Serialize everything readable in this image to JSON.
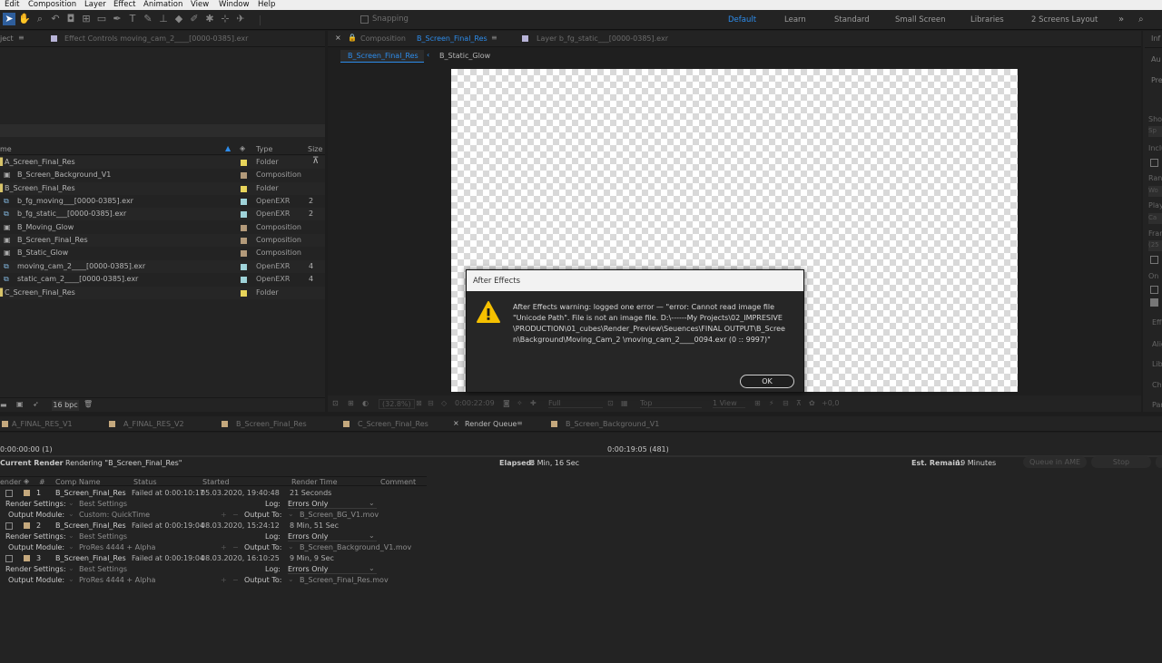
{
  "menu": [
    "Edit",
    "Composition",
    "Layer",
    "Effect",
    "Animation",
    "View",
    "Window",
    "Help"
  ],
  "toolbar": {
    "snapping": "Snapping"
  },
  "workspaces": [
    "Default",
    "Learn",
    "Standard",
    "Small Screen",
    "Libraries",
    "2 Screens Layout"
  ],
  "project_panel": {
    "tab_project": "ject",
    "tab_effect_controls": "Effect Controls moving_cam_2____[0000-0385].exr",
    "col_name": "me",
    "col_type": "Type",
    "col_size": "Size",
    "items": [
      {
        "name": "A_Screen_Final_Res",
        "type": "Folder",
        "size": "",
        "color": "#e8d45a"
      },
      {
        "name": "B_Screen_Background_V1",
        "type": "Composition",
        "size": "",
        "color": "#b39a7a"
      },
      {
        "name": "B_Screen_Final_Res",
        "type": "Folder",
        "size": "",
        "color": "#e8d45a"
      },
      {
        "name": "b_fg_moving___[0000-0385].exr",
        "type": "OpenEXR",
        "size": "2",
        "color": "#9fd3d9"
      },
      {
        "name": "b_fg_static___[0000-0385].exr",
        "type": "OpenEXR",
        "size": "2",
        "color": "#9fd3d9"
      },
      {
        "name": "B_Moving_Glow",
        "type": "Composition",
        "size": "",
        "color": "#b39a7a"
      },
      {
        "name": "B_Screen_Final_Res",
        "type": "Composition",
        "size": "",
        "color": "#b39a7a"
      },
      {
        "name": "B_Static_Glow",
        "type": "Composition",
        "size": "",
        "color": "#b39a7a"
      },
      {
        "name": "moving_cam_2____[0000-0385].exr",
        "type": "OpenEXR",
        "size": "4",
        "color": "#9fd3d9"
      },
      {
        "name": "static_cam_2____[0000-0385].exr",
        "type": "OpenEXR",
        "size": "4",
        "color": "#9fd3d9"
      },
      {
        "name": "C_Screen_Final_Res",
        "type": "Folder",
        "size": "",
        "color": "#e8d45a"
      }
    ],
    "bpc": "16 bpc"
  },
  "composition_panel": {
    "tab_comp_prefix": "Composition",
    "tab_comp_name": "B_Screen_Final_Res",
    "tab_layer": "Layer b_fg_static___[0000-0385].exr",
    "breadcrumb_active": "B_Screen_Final_Res",
    "breadcrumb_next": "B_Static_Glow",
    "footer": {
      "zoom": "(32.8%)",
      "timecode": "0:00:22:09",
      "resolution": "Full",
      "view": "Top",
      "views": "1 View",
      "exposure": "+0,0"
    }
  },
  "right_panel": {
    "tabs": [
      "Inf",
      "Au",
      "Pre",
      "Sho",
      "Sp",
      "Inclu",
      "Ran",
      "Wo",
      "Play",
      "Ca",
      "Fran",
      "(25",
      "On",
      "Eff",
      "Alig",
      "Libr",
      "Cha",
      "Par"
    ]
  },
  "timeline_tabs": [
    "A_FINAL_RES_V1",
    "A_FINAL_RES_V2",
    "B_Screen_Final_Res",
    "C_Screen_Final_Res",
    "Render Queue",
    "B_Screen_Background_V1"
  ],
  "render_queue": {
    "time_left": "0:00:00:00 (1)",
    "time_right": "0:00:19:05 (481)",
    "current_render_label": "Current Render",
    "rendering_text": "Rendering \"B_Screen_Final_Res\"",
    "elapsed_label": "Elapsed:",
    "elapsed": "8 Min, 16 Sec",
    "remain_label": "Est. Remain:",
    "remain": "19 Minutes",
    "queue_ame": "Queue in AME",
    "stop": "Stop",
    "headers": {
      "render": "ender",
      "num": "#",
      "comp": "Comp Name",
      "status": "Status",
      "started": "Started",
      "render_time": "Render Time",
      "comment": "Comment"
    },
    "rs_label": "Render Settings:",
    "om_label": "Output Module:",
    "log_label": "Log:",
    "out_label": "Output To:",
    "items": [
      {
        "num": "1",
        "comp": "B_Screen_Final_Res",
        "status": "Failed at 0:00:10:17",
        "started": "05.03.2020, 19:40:48",
        "time": "21 Seconds",
        "rs": "Best Settings",
        "om": "Custom: QuickTime",
        "log": "Errors Only",
        "out": "B_Screen_BG_V1.mov"
      },
      {
        "num": "2",
        "comp": "B_Screen_Final_Res",
        "status": "Failed at 0:00:19:04",
        "started": "08.03.2020, 15:24:12",
        "time": "8 Min, 51 Sec",
        "rs": "Best Settings",
        "om": "ProRes 4444 + Alpha",
        "log": "Errors Only",
        "out": "B_Screen_Background_V1.mov"
      },
      {
        "num": "3",
        "comp": "B_Screen_Final_Res",
        "status": "Failed at 0:00:19:04",
        "started": "08.03.2020, 16:10:25",
        "time": "9 Min, 9 Sec",
        "rs": "Best Settings",
        "om": "ProRes 4444 + Alpha",
        "log": "Errors Only",
        "out": "B_Screen_Final_Res.mov"
      }
    ]
  },
  "dialog": {
    "title": "After Effects",
    "message": "After Effects warning: logged one error — \"error: Cannot read image file \"Unicode Path\". File is not an image file. D:\\------My Projects\\02_IMPRESIVE\\PRODUCTION\\01_cubes\\Render_Preview\\Seuences\\FINAL OUTPUT\\B_Screen\\Background\\Moving_Cam_2 \\moving_cam_2____0094.exr (0  ::  9997)\"",
    "ok": "OK"
  },
  "colors": {
    "accent": "#2d8ceb",
    "folder": "#e8d45a",
    "comp": "#b39a7a",
    "footage": "#9fd3d9",
    "warning": "#f5c000"
  }
}
